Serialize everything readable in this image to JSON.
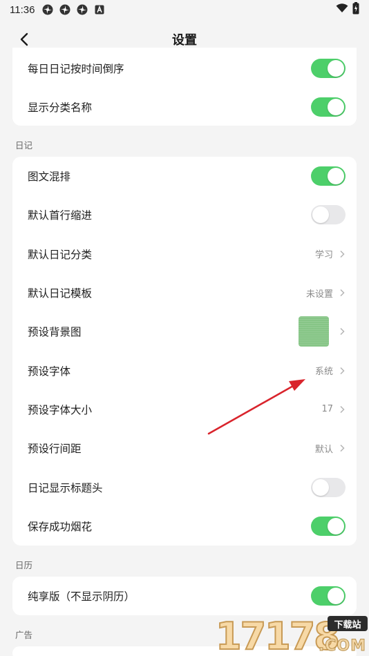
{
  "status_bar": {
    "time": "11:36",
    "notif_icons": [
      "pinwheel-icon",
      "pinwheel-icon",
      "pinwheel-icon",
      "a-box-icon"
    ],
    "right_icons": [
      "wifi-icon",
      "battery-charging-icon"
    ]
  },
  "nav": {
    "back_icon": "chevron-left-icon",
    "title": "设置"
  },
  "top_card": {
    "items": [
      {
        "label": "每日日记按时间倒序",
        "toggle": true
      },
      {
        "label": "显示分类名称",
        "toggle": true
      }
    ]
  },
  "sections": [
    {
      "title": "日记",
      "items": [
        {
          "label": "图文混排",
          "toggle": true
        },
        {
          "label": "默认首行缩进",
          "toggle": false
        },
        {
          "label": "默认日记分类",
          "value": "学习"
        },
        {
          "label": "默认日记模板",
          "value": "未设置"
        },
        {
          "label": "预设背景图",
          "thumbnail_color": "#86c586"
        },
        {
          "label": "预设字体",
          "value": "系统"
        },
        {
          "label": "预设字体大小",
          "value": "17"
        },
        {
          "label": "预设行间距",
          "value": "默认"
        },
        {
          "label": "日记显示标题头",
          "toggle": false
        },
        {
          "label": "保存成功烟花",
          "toggle": true
        }
      ]
    },
    {
      "title": "日历",
      "items": [
        {
          "label": "纯享版（不显示阴历）",
          "toggle": true
        }
      ]
    },
    {
      "title": "广告",
      "items": []
    }
  ],
  "annotation": {
    "type": "red-arrow",
    "color": "#d9242c"
  },
  "watermark": {
    "digits": "17178",
    "tag": "下载站",
    "suffix": ".COM"
  },
  "colors": {
    "toggle_on": "#4dcf6a",
    "toggle_off": "#e8e8ea",
    "background": "#f4f4f4",
    "card": "#ffffff",
    "value_text": "#8a8a8a"
  }
}
